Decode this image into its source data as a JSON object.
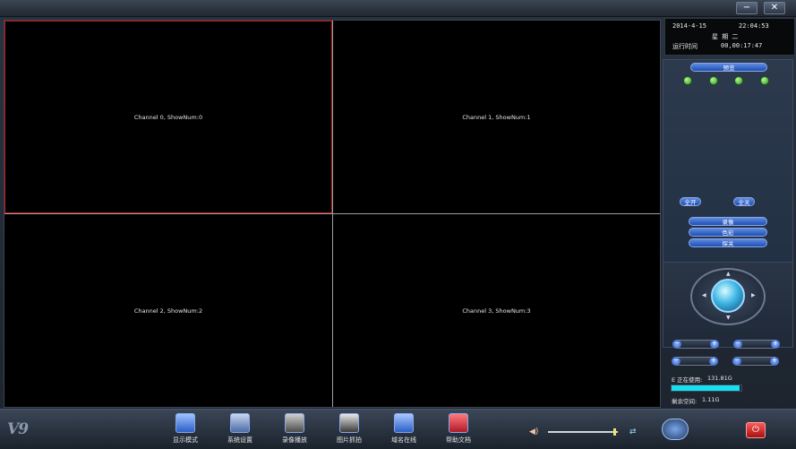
{
  "window": {
    "minimize_glyph": "−",
    "close_glyph": "✕"
  },
  "channels": [
    {
      "label": "Channel 0, ShowNum:0"
    },
    {
      "label": "Channel 1, ShowNum:1"
    },
    {
      "label": "Channel 2, ShowNum:2"
    },
    {
      "label": "Channel 3, ShowNum:3"
    }
  ],
  "clock": {
    "date": "2014-4-15",
    "time": "22:04:53",
    "weekday": "星 期 二",
    "runtime_label": "运行时间",
    "runtime": "00,00:17:47"
  },
  "controls": {
    "preview": "预览",
    "all_open": "全开",
    "all_close": "全关",
    "record": "录像",
    "color": "色彩",
    "close": "探关"
  },
  "ptz": {
    "plus": "+",
    "minus": "−"
  },
  "disk": {
    "used_label": "E 正在使用:",
    "used_value": "131.81G",
    "used_fraction": 0.98,
    "free_label": "剩余空间:",
    "free_value": "1.11G"
  },
  "bottom": {
    "logo": "V9",
    "buttons": [
      {
        "label": "显示模式",
        "icon": "monitor-icon"
      },
      {
        "label": "系统设置",
        "icon": "settings-icon"
      },
      {
        "label": "录像播放",
        "icon": "camera-icon"
      },
      {
        "label": "图片抓拍",
        "icon": "film-icon"
      },
      {
        "label": "域名在线",
        "icon": "network-icon"
      },
      {
        "label": "帮助文档",
        "icon": "help-icon"
      }
    ],
    "volume_level": 0.98
  },
  "colors": {
    "accent": "#1e4fb4",
    "disk_bar": "#19e0f0",
    "selected_border": "#c01818"
  }
}
